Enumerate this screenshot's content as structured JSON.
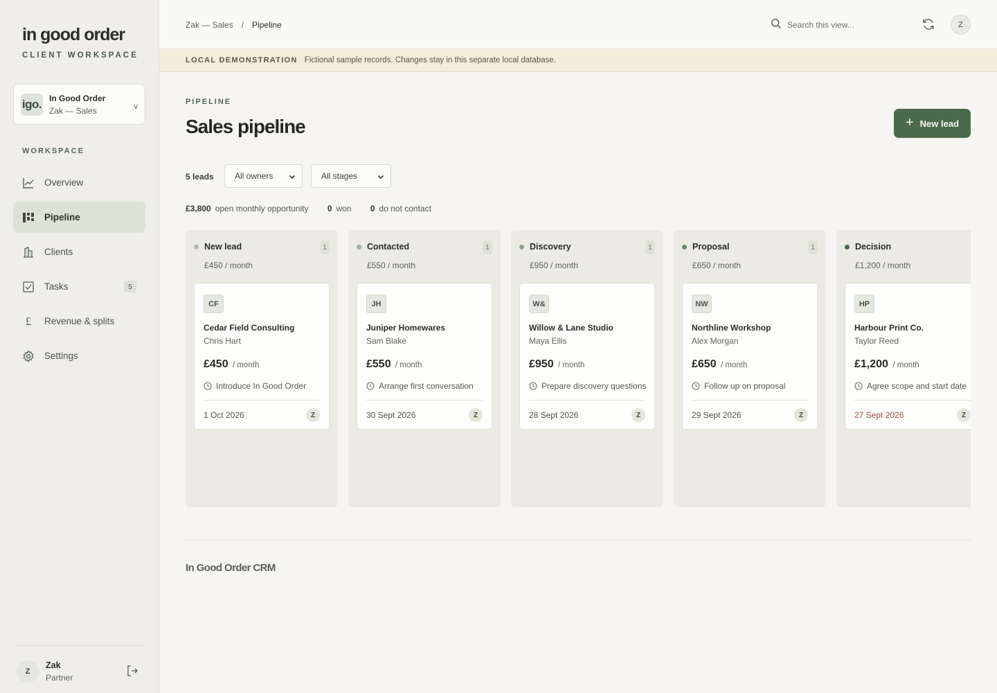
{
  "sidebar": {
    "brand": "in good order",
    "brand_sub": "CLIENT WORKSPACE",
    "org": {
      "logo": "igo.",
      "name": "In Good Order",
      "sub": "Zak — Sales",
      "chevron": "v"
    },
    "section_label": "WORKSPACE",
    "items": [
      {
        "label": "Overview",
        "icon": "chart-line-icon"
      },
      {
        "label": "Pipeline",
        "icon": "kanban-icon",
        "active": true
      },
      {
        "label": "Clients",
        "icon": "building-icon"
      },
      {
        "label": "Tasks",
        "icon": "checkbox-icon",
        "badge": "5"
      },
      {
        "label": "Revenue & splits",
        "icon": "pound-icon"
      },
      {
        "label": "Settings",
        "icon": "gear-icon"
      }
    ],
    "user": {
      "initial": "Z",
      "name": "Zak",
      "role": "Partner"
    }
  },
  "topbar": {
    "breadcrumb": {
      "parent": "Zak — Sales",
      "separator": "/",
      "current": "Pipeline"
    },
    "search_placeholder": "Search this view...",
    "avatar": "Z"
  },
  "banner": {
    "title": "LOCAL DEMONSTRATION",
    "text": "Fictional sample records. Changes stay in this separate local database."
  },
  "main": {
    "eyebrow": "PIPELINE",
    "title": "Sales pipeline",
    "new_lead_label": "New lead",
    "lead_count": "5 leads",
    "filters": {
      "owner": "All owners",
      "stage": "All stages"
    },
    "stats": {
      "opportunity_value": "£3,800",
      "opportunity_label": "open monthly opportunity",
      "won_value": "0",
      "won_label": "won",
      "dnc_value": "0",
      "dnc_label": "do not contact"
    }
  },
  "columns": [
    {
      "name": "New lead",
      "count": "1",
      "total": "£450 / month",
      "dot_color": "#b5b7ae",
      "card": {
        "initials": "CF",
        "company": "Cedar Field Consulting",
        "contact": "Chris Hart",
        "amount": "£450",
        "unit": "/ month",
        "task": "Introduce In Good Order",
        "date": "1 Oct 2026",
        "owner": "Z",
        "overdue": false
      }
    },
    {
      "name": "Contacted",
      "count": "1",
      "total": "£550 / month",
      "dot_color": "#9fb39b",
      "card": {
        "initials": "JH",
        "company": "Juniper Homewares",
        "contact": "Sam Blake",
        "amount": "£550",
        "unit": "/ month",
        "task": "Arrange first conversation",
        "date": "30 Sept 2026",
        "owner": "Z",
        "overdue": false
      }
    },
    {
      "name": "Discovery",
      "count": "1",
      "total": "£950 / month",
      "dot_color": "#8aa487",
      "card": {
        "initials": "W&",
        "company": "Willow & Lane Studio",
        "contact": "Maya Ellis",
        "amount": "£950",
        "unit": "/ month",
        "task": "Prepare discovery questions",
        "date": "28 Sept 2026",
        "owner": "Z",
        "overdue": false
      }
    },
    {
      "name": "Proposal",
      "count": "1",
      "total": "£650 / month",
      "dot_color": "#6b8b68",
      "card": {
        "initials": "NW",
        "company": "Northline Workshop",
        "contact": "Alex Morgan",
        "amount": "£650",
        "unit": "/ month",
        "task": "Follow up on proposal",
        "date": "29 Sept 2026",
        "owner": "Z",
        "overdue": false
      }
    },
    {
      "name": "Decision",
      "count": "1",
      "total": "£1,200 / month",
      "dot_color": "#4b6b49",
      "card": {
        "initials": "HP",
        "company": "Harbour Print Co.",
        "contact": "Taylor Reed",
        "amount": "£1,200",
        "unit": "/ month",
        "task": "Agree scope and start date",
        "date": "27 Sept 2026",
        "owner": "Z",
        "overdue": true
      }
    }
  ],
  "footer": {
    "brand": "In Good Order CRM"
  },
  "colors": {
    "accent": "#4a6a4c",
    "active_nav": "#dce3d6",
    "banner": "#f3ecdb",
    "overdue": "#a04a40"
  }
}
